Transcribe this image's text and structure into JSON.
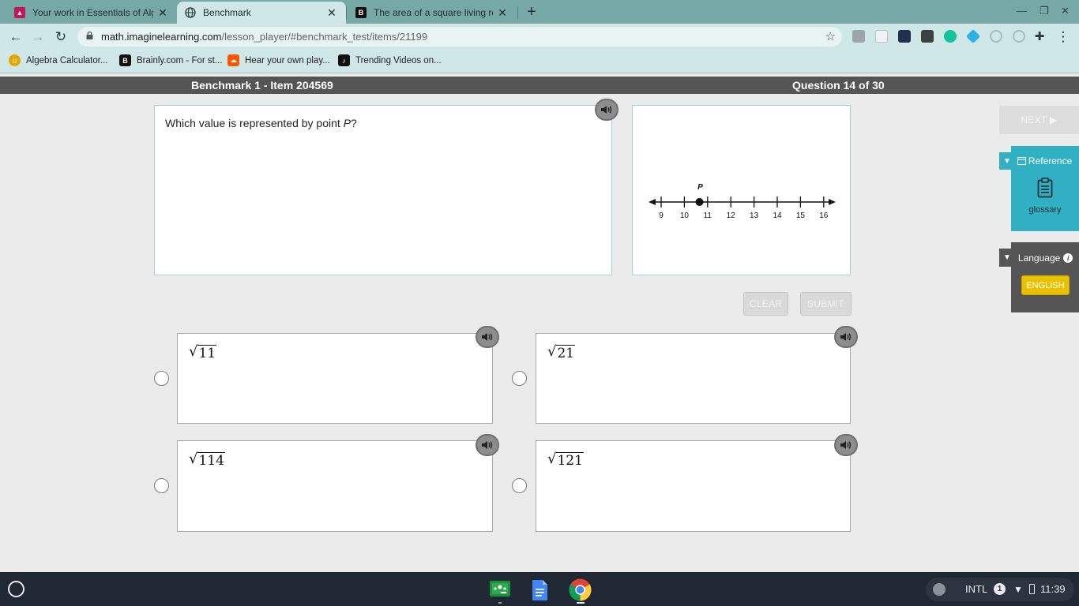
{
  "browser": {
    "tabs": [
      {
        "title": "Your work in Essentials of Algebra",
        "active": false
      },
      {
        "title": "Benchmark",
        "active": true
      },
      {
        "title": "The area of a square living room",
        "active": false
      }
    ],
    "url_host": "math.imaginelearning.com",
    "url_path": "/lesson_player/#benchmark_test/items/21199",
    "bookmarks": [
      {
        "label": "Algebra Calculator..."
      },
      {
        "label": "Brainly.com - For st..."
      },
      {
        "label": "Hear your own play..."
      },
      {
        "label": "Trending Videos on..."
      }
    ]
  },
  "header": {
    "title": "Benchmark 1 - Item 204569",
    "progress": "Question 14 of 30"
  },
  "question": {
    "text_before": "Which value is represented by point ",
    "variable": "P",
    "text_after": "?"
  },
  "number_line": {
    "point_label": "P",
    "point_value": 10.65,
    "min": 9,
    "max": 16,
    "ticks": [
      "9",
      "10",
      "11",
      "12",
      "13",
      "14",
      "15",
      "16"
    ]
  },
  "buttons": {
    "clear": "CLEAR",
    "submit": "SUBMIT",
    "next": "NEXT ▶"
  },
  "answers": [
    {
      "radicand": "11",
      "selected": false
    },
    {
      "radicand": "21",
      "selected": false
    },
    {
      "radicand": "114",
      "selected": false
    },
    {
      "radicand": "121",
      "selected": false
    }
  ],
  "sidebar": {
    "reference_label": "Reference",
    "glossary_label": "glossary",
    "language_label": "Language",
    "language_value": "ENGLISH"
  },
  "taskbar": {
    "keyboard": "INTL",
    "notifications": "1",
    "time": "11:39"
  },
  "colors": {
    "accent_teal": "#30b0c2",
    "header_gray": "#555555",
    "language_yellow": "#e8c100"
  }
}
